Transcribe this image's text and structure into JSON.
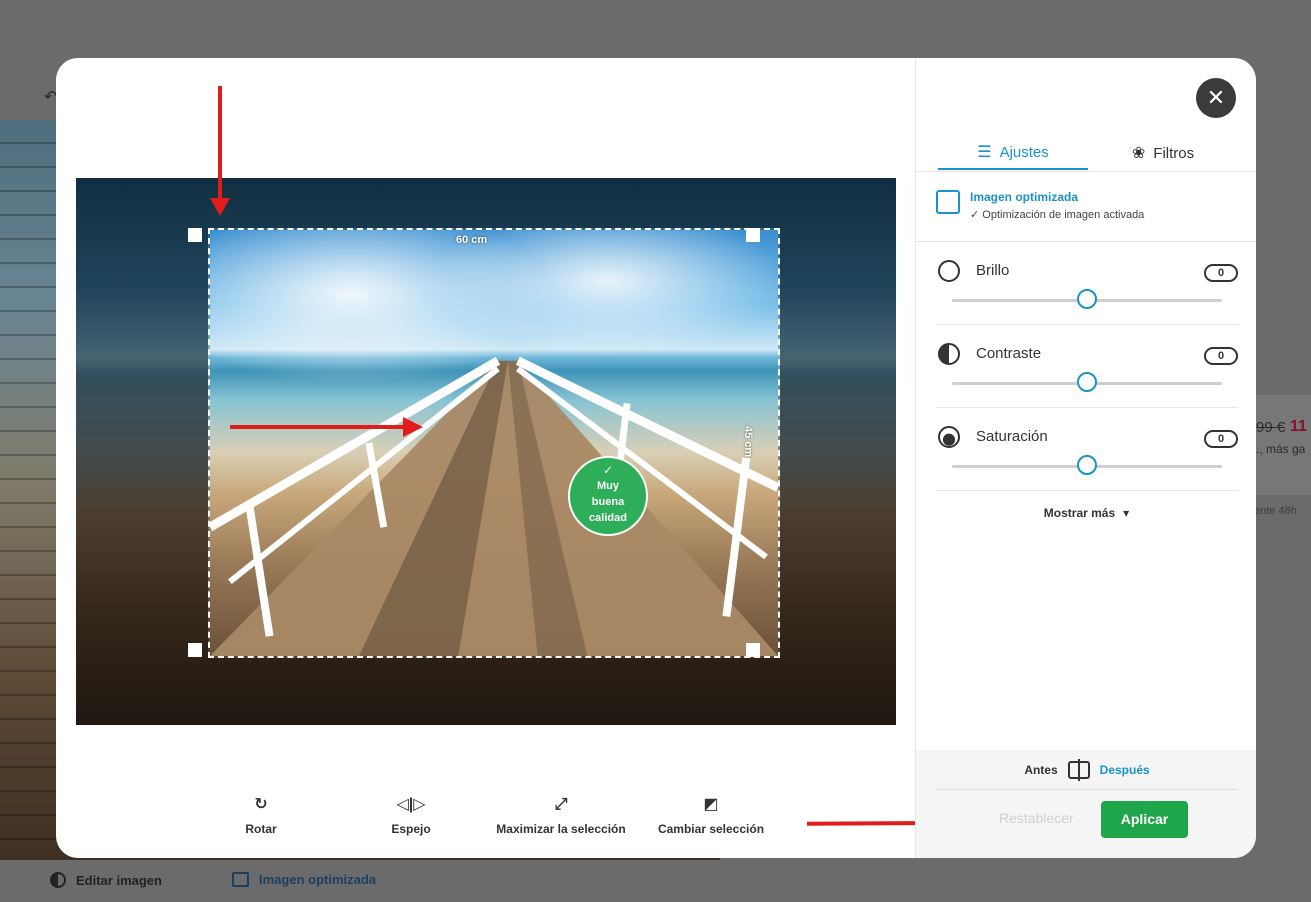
{
  "background": {
    "price_old": "99 €",
    "price_new": "11",
    "more_text": "., más ga",
    "shipping_text": "ente 48h",
    "edit_image": "Editar imagen",
    "optimized_image": "Imagen optimizada"
  },
  "canvas": {
    "width_label": "60 cm",
    "height_label": "45 cm",
    "quality_badge": {
      "check": "✓",
      "line1": "Muy",
      "line2": "buena",
      "line3": "calidad"
    }
  },
  "toolbar": {
    "rotate": "Rotar",
    "mirror": "Espejo",
    "maximize": "Maximizar la selección",
    "change": "Cambiar selección"
  },
  "panel": {
    "tabs": [
      {
        "label": "Ajustes",
        "icon": "sliders-icon",
        "active": true
      },
      {
        "label": "Filtros",
        "icon": "filters-icon",
        "active": false
      }
    ],
    "optimization": {
      "title": "Imagen optimizada",
      "subtitle": "✓ Optimización de imagen activada"
    },
    "adjustments": [
      {
        "label": "Brillo",
        "value": "0",
        "icon": "sun-icon",
        "level": 0.5
      },
      {
        "label": "Contraste",
        "value": "0",
        "icon": "contrast-icon",
        "level": 0.5
      },
      {
        "label": "Saturación",
        "value": "0",
        "icon": "saturation-icon",
        "level": 0.5
      }
    ],
    "show_more": "Mostrar más",
    "compare": {
      "before": "Antes",
      "after": "Después"
    },
    "reset": "Restablecer",
    "apply": "Aplicar"
  },
  "colors": {
    "accent": "#1a93c9",
    "apply": "#1fa64a",
    "quality": "#2fae5a",
    "annotation_arrow": "#e21b1b"
  }
}
